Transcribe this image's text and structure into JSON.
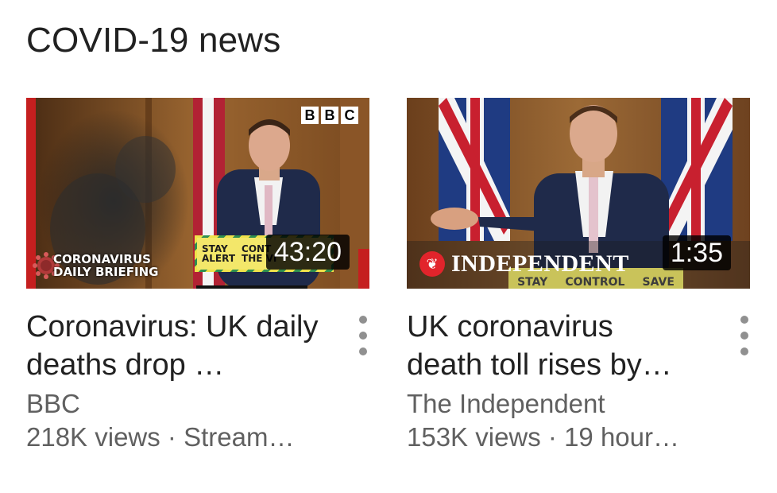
{
  "shelf": {
    "title": "COVID-19 news"
  },
  "videos": [
    {
      "title": "Coronavirus: UK daily deaths drop …",
      "channel": "BBC",
      "stats": "218K views · Stream…",
      "duration": "43:20",
      "overlay": {
        "logo": [
          "B",
          "B",
          "C"
        ],
        "briefing": [
          "CORONAVIRUS",
          "DAILY BRIEFING"
        ],
        "banner": [
          "STAY",
          "ALERT",
          "CONT",
          "THE VI"
        ]
      }
    },
    {
      "title": "UK coronavirus death toll rises by…",
      "channel": "The Independent",
      "stats": "153K views · 19 hour…",
      "duration": "1:35",
      "overlay": {
        "brand": "INDEPENDENT",
        "strip": [
          "STAY",
          "CONTROL",
          "SAVE"
        ]
      }
    }
  ],
  "icons": {
    "menu": "more-vert-icon",
    "eagle": "eagle-icon",
    "virus": "virus-icon"
  },
  "colors": {
    "title": "#212121",
    "meta": "#606060",
    "duration_bg": "#000000"
  }
}
